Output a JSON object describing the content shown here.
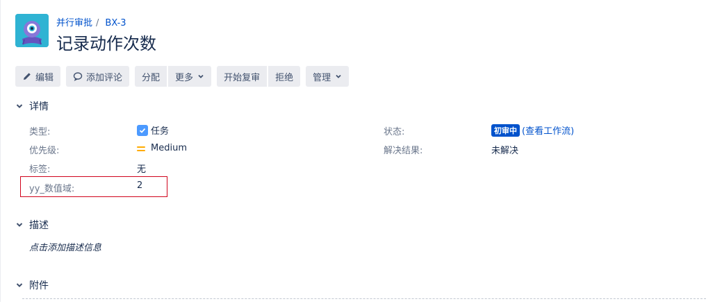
{
  "issue": {
    "project_name": "并行审批",
    "issue_key": "BX-3",
    "summary": "记录动作次数"
  },
  "toolbar": {
    "edit": "编辑",
    "comment": "添加评论",
    "assign": "分配",
    "more": "更多",
    "start_review": "开始复审",
    "reject": "拒绝",
    "admin": "管理"
  },
  "details": {
    "heading": "详情",
    "type_label": "类型:",
    "type_value": "任务",
    "priority_label": "优先级:",
    "priority_value": "Medium",
    "labels_label": "标签:",
    "labels_value": "无",
    "custom_label": "yy_数值域:",
    "custom_value": "2",
    "status_label": "状态:",
    "status_value": "初审中",
    "workflow_link": "(查看工作流)",
    "resolution_label": "解决结果:",
    "resolution_value": "未解决"
  },
  "description": {
    "heading": "描述",
    "placeholder": "点击添加描述信息"
  },
  "attachments": {
    "heading": "附件"
  },
  "colors": {
    "link": "#0052cc",
    "button_bg": "#ebecf0",
    "status_lozenge": "#0052cc",
    "highlight_border": "#d0021b",
    "priority_medium": "#ffab00",
    "project_logo_bg": "#2fb3d3"
  }
}
